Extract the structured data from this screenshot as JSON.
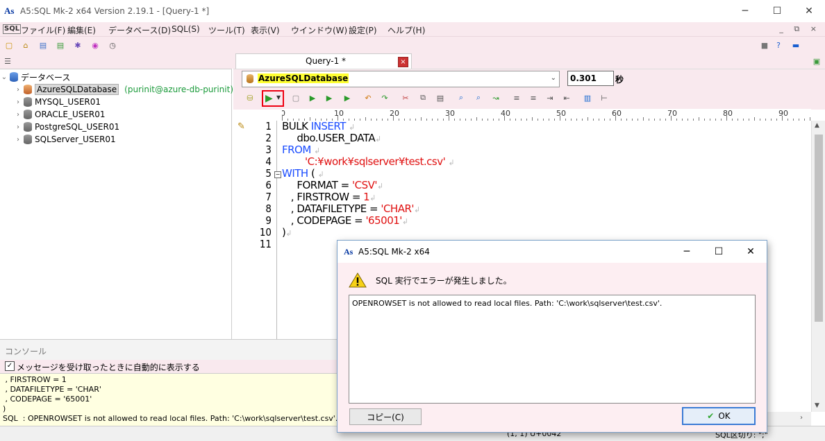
{
  "window": {
    "title": "A5:SQL Mk-2 x64 Version 2.19.1 - [Query-1 *]",
    "logo": "As",
    "min": "─",
    "max": "☐",
    "close": "✕"
  },
  "menu": {
    "sql_icon": "SQL",
    "items": [
      "ファイル(F)",
      "編集(E)",
      "データベース(D)",
      "SQL(S)",
      "ツール(T)",
      "表示(V)",
      "ウインドウ(W)",
      "設定(P)",
      "ヘルプ(H)"
    ],
    "mdi": "_ ⧉ ×"
  },
  "tree": {
    "root": "データベース",
    "items": [
      {
        "label": "AzureSQLDatabase",
        "conn": "(purinit@azure-db-purinit)"
      },
      {
        "label": "MYSQL_USER01"
      },
      {
        "label": "ORACLE_USER01"
      },
      {
        "label": "PostgreSQL_USER01"
      },
      {
        "label": "SQLServer_USER01"
      }
    ]
  },
  "tab": {
    "label": "Query-1 *",
    "close": "×"
  },
  "editor": {
    "database": "AzureSQLDatabase",
    "timer": "0.301",
    "timer_unit": "秒",
    "ruler": [
      "0",
      "10",
      "20",
      "30",
      "40",
      "50",
      "60",
      "70",
      "80",
      "90"
    ],
    "line_numbers": [
      "1",
      "2",
      "3",
      "4",
      "5",
      "6",
      "7",
      "8",
      "9",
      "10",
      "11"
    ]
  },
  "code": {
    "l1a": "BULK ",
    "l1b": "INSERT",
    "l2": "     dbo.USER_DATA",
    "l3": "FROM",
    "l4": "'C:¥work¥sqlserver¥test.csv'",
    "l5a": "WITH",
    "l5b": " (",
    "l6a": "     FORMAT = ",
    "l6b": "'CSV'",
    "l7a": "   , FIRSTROW = ",
    "l7b": "1",
    "l8a": "   , DATAFILETYPE = ",
    "l8b": "'CHAR'",
    "l9a": "   , CODEPAGE = ",
    "l9b": "'65001'",
    "l10": ")",
    "eol": "↲"
  },
  "console": {
    "title": "コンソール",
    "option": "メッセージを受け取ったときに自動的に表示する",
    "log": [
      " , FIRSTROW = 1",
      " , DATAFILETYPE = 'CHAR'",
      " , CODEPAGE = '65001'",
      ")",
      "SQL  : OPENROWSET is not allowed to read local files. Path: 'C:\\work\\sqlserver\\test.csv'."
    ]
  },
  "status": {
    "position": "(1, 1) U+0042",
    "delimiter": "SQL区切り: \";\""
  },
  "dialog": {
    "title": "A5:SQL Mk-2 x64",
    "message": "SQL 実行でエラーが発生しました。",
    "detail": "OPENROWSET is not allowed to read local files. Path: 'C:\\work\\sqlserver\\test.csv'.",
    "copy_button": "コピー(C)",
    "ok_button": "OK"
  }
}
